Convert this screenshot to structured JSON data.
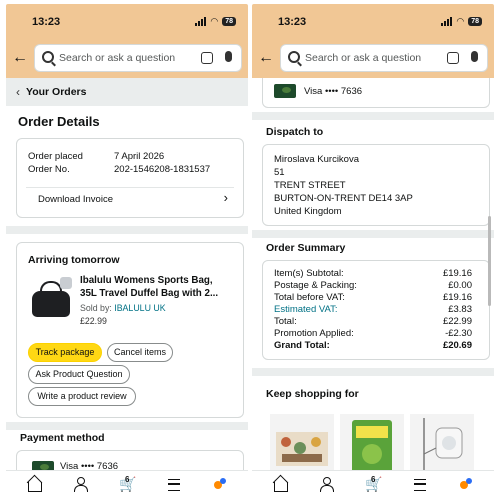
{
  "status_bar": {
    "time": "13:23",
    "battery": "78"
  },
  "search": {
    "placeholder": "Search or ask a question"
  },
  "left_panel": {
    "breadcrumb": "Your Orders",
    "title": "Order Details",
    "order": {
      "placed_label": "Order placed",
      "placed_value": "7 April 2026",
      "number_label": "Order No.",
      "number_value": "202-1546208-1831537",
      "download_invoice": "Download Invoice"
    },
    "shipment": {
      "heading": "Arriving tomorrow",
      "product_title": "Ibalulu Womens Sports Bag, 35L Travel Duffel Bag with 2...",
      "sold_by_label": "Sold by:",
      "seller": "IBALULU UK",
      "price": "£22.99",
      "buttons": {
        "track": "Track package",
        "cancel": "Cancel items",
        "ask": "Ask Product Question",
        "review": "Write a product review"
      }
    },
    "payment": {
      "heading": "Payment method",
      "card": "Visa •••• 7636"
    }
  },
  "right_panel": {
    "payment_card": "Visa •••• 7636",
    "dispatch": {
      "heading": "Dispatch to",
      "address": [
        "Miroslava Kurcikova",
        "51",
        "TRENT STREET",
        "BURTON-ON-TRENT DE14 3AP",
        "United Kingdom"
      ]
    },
    "summary": {
      "heading": "Order Summary",
      "rows": [
        {
          "label": "Item(s) Subtotal:",
          "value": "£19.16"
        },
        {
          "label": "Postage & Packing:",
          "value": "£0.00"
        },
        {
          "label": "Total before VAT:",
          "value": "£19.16"
        },
        {
          "label": "Estimated VAT:",
          "value": "£3.83"
        },
        {
          "label": "Total:",
          "value": "£22.99"
        },
        {
          "label": "Promotion Applied:",
          "value": "-£2.30"
        },
        {
          "label": "Grand Total:",
          "value": "£20.69"
        }
      ]
    },
    "keep_shopping": {
      "heading": "Keep shopping for"
    }
  },
  "bottom_nav": {
    "cart_count": "6"
  },
  "colors": {
    "header": "#f1c795",
    "link": "#007185",
    "track_button": "#ffd814"
  }
}
